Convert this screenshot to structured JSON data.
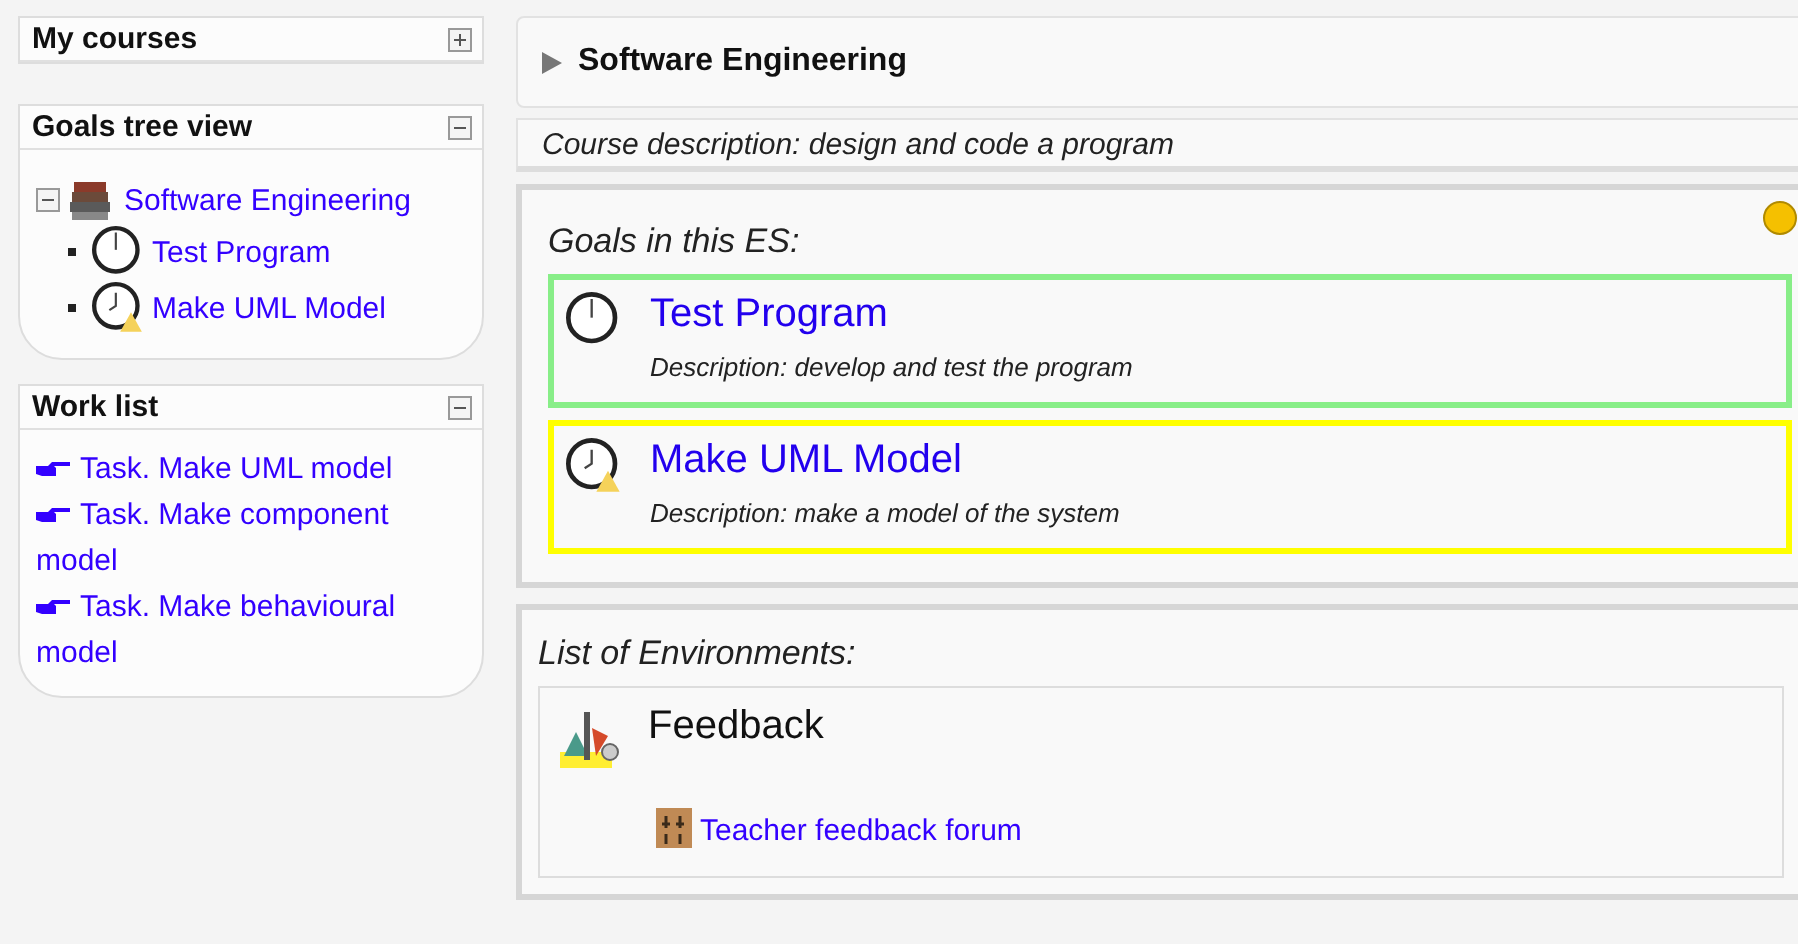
{
  "sidebar": {
    "blocks": [
      {
        "title": "My courses",
        "expanded": false
      },
      {
        "kind": "tree",
        "title": "Goals tree view",
        "expanded": true,
        "tree": [
          {
            "label": "Software Engineering",
            "expanded": true,
            "children": [
              {
                "label": "Test Program",
                "kind": "clock"
              },
              {
                "label": "Make UML Model",
                "kind": "clock-warning"
              }
            ]
          }
        ]
      },
      {
        "kind": "list",
        "title": "Work list",
        "expanded": true,
        "items": [
          "Task. Make UML model",
          "Task. Make component model",
          "Task. Make behavioural model"
        ]
      }
    ]
  },
  "course": {
    "title": "Software Engineering",
    "description": "Course description: design and code a program"
  },
  "goals": {
    "heading": "Goals in this ES:",
    "items": [
      {
        "title": "Test Program",
        "description": "Description: develop and test the program",
        "kind": "clock",
        "color": "#88ee88"
      },
      {
        "title": "Make UML Model",
        "description": "Description: make a model of the system",
        "kind": "clock-warning",
        "color": "#ffff00"
      }
    ]
  },
  "environments": {
    "heading": "List of Environments:",
    "items": [
      {
        "title": "Feedback",
        "links": [
          "Teacher feedback forum"
        ]
      }
    ]
  }
}
